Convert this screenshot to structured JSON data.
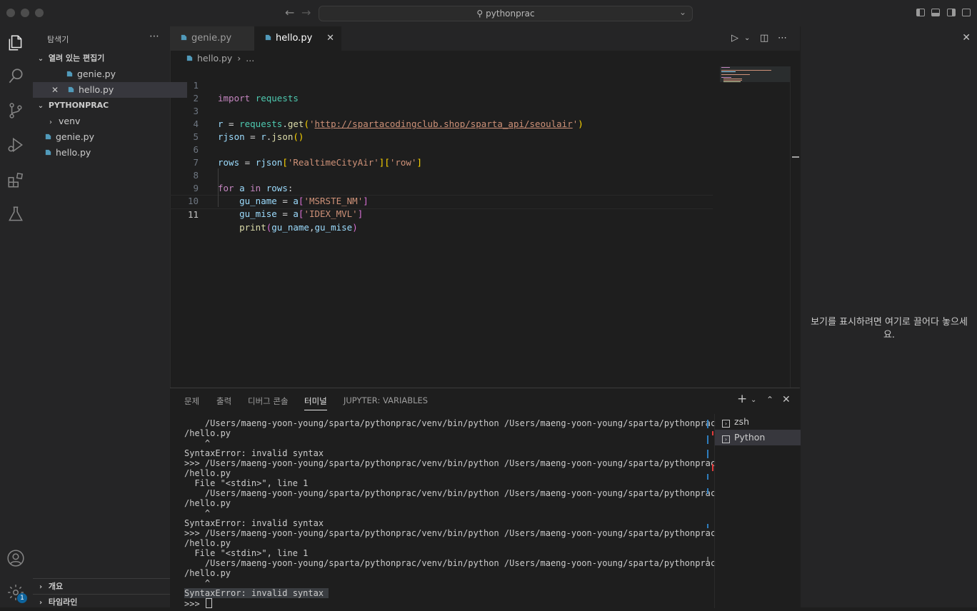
{
  "titlebar": {
    "search_text": "pythonprac"
  },
  "sidebar": {
    "title": "탐색기",
    "open_editors_label": "열려 있는 편집기",
    "open_editors": [
      "genie.py",
      "hello.py"
    ],
    "project_label": "PYTHONPRAC",
    "tree": [
      {
        "name": "venv",
        "type": "folder"
      },
      {
        "name": "genie.py",
        "type": "file"
      },
      {
        "name": "hello.py",
        "type": "file"
      }
    ],
    "outline_label": "개요",
    "timeline_label": "타임라인"
  },
  "tabs": [
    {
      "label": "genie.py",
      "active": false
    },
    {
      "label": "hello.py",
      "active": true
    }
  ],
  "breadcrumb": {
    "file": "hello.py",
    "rest": "..."
  },
  "code": {
    "current_line": 11,
    "line_numbers": [
      "1",
      "2",
      "3",
      "4",
      "5",
      "6",
      "7",
      "8",
      "9",
      "10",
      "11"
    ],
    "l1": {
      "kw": "import",
      "mod": "requests"
    },
    "l3": {
      "var": "r",
      "eq": " = ",
      "obj": "requests",
      "dot": ".",
      "fn": "get",
      "open": "(",
      "q1": "'",
      "url": "http://spartacodingclub.shop/sparta_api/seoulair",
      "q2": "'",
      "close": ")"
    },
    "l4": {
      "var": "rjson",
      "eq": " = ",
      "obj": "r",
      "dot": ".",
      "fn": "json",
      "parens": "()"
    },
    "l6": {
      "var": "rows",
      "eq": " = ",
      "obj": "rjson",
      "o1": "[",
      "k1": "'RealtimeCityAir'",
      "c1": "]",
      "o2": "[",
      "k2": "'row'",
      "c2": "]"
    },
    "l8": {
      "kw_for": "for",
      "var": " a ",
      "kw_in": "in",
      "iter": " rows",
      "colon": ":"
    },
    "l9": {
      "indent": "    ",
      "var": "gu_name",
      "eq": " = ",
      "obj": "a",
      "o": "[",
      "k": "'MSRSTE_NM'",
      "c": "]"
    },
    "l10": {
      "indent": "    ",
      "var": "gu_mise",
      "eq": " = ",
      "obj": "a",
      "o": "[",
      "k": "'IDEX_MVL'",
      "c": "]"
    },
    "l11": {
      "indent": "    ",
      "fn": "print",
      "o": "(",
      "a1": "gu_name",
      "comma": ",",
      "a2": "gu_mise",
      "c": ")"
    }
  },
  "aux_panel": {
    "message": "보기를 표시하려면 여기로 끌어다 놓으세요."
  },
  "panel": {
    "tabs": [
      "문제",
      "출력",
      "디버그 콘솔",
      "터미널",
      "JUPYTER: VARIABLES"
    ],
    "active_tab": "터미널",
    "terminal_lines": [
      "    /Users/maeng-yoon-young/sparta/pythonprac/venv/bin/python /Users/maeng-yoon-young/sparta/pythonprac",
      "/hello.py",
      "    ^",
      "SyntaxError: invalid syntax",
      ">>> /Users/maeng-yoon-young/sparta/pythonprac/venv/bin/python /Users/maeng-yoon-young/sparta/pythonprac",
      "/hello.py",
      "  File \"<stdin>\", line 1",
      "    /Users/maeng-yoon-young/sparta/pythonprac/venv/bin/python /Users/maeng-yoon-young/sparta/pythonprac",
      "/hello.py",
      "    ^",
      "SyntaxError: invalid syntax",
      ">>> /Users/maeng-yoon-young/sparta/pythonprac/venv/bin/python /Users/maeng-yoon-young/sparta/pythonprac",
      "/hello.py",
      "  File \"<stdin>\", line 1",
      "    /Users/maeng-yoon-young/sparta/pythonprac/venv/bin/python /Users/maeng-yoon-young/sparta/pythonprac",
      "/hello.py",
      "    ^",
      "SyntaxError: invalid syntax ",
      ">>> "
    ],
    "terminals": [
      "zsh",
      "Python"
    ],
    "selected_terminal": "Python"
  },
  "activity": {
    "settings_badge": "1"
  },
  "colors": {
    "keyword": "#c586c0",
    "variable": "#9cdcfe",
    "function": "#dcdcaa",
    "string": "#ce9178",
    "bracket": "#ffd700",
    "accent": "#0e639c"
  }
}
